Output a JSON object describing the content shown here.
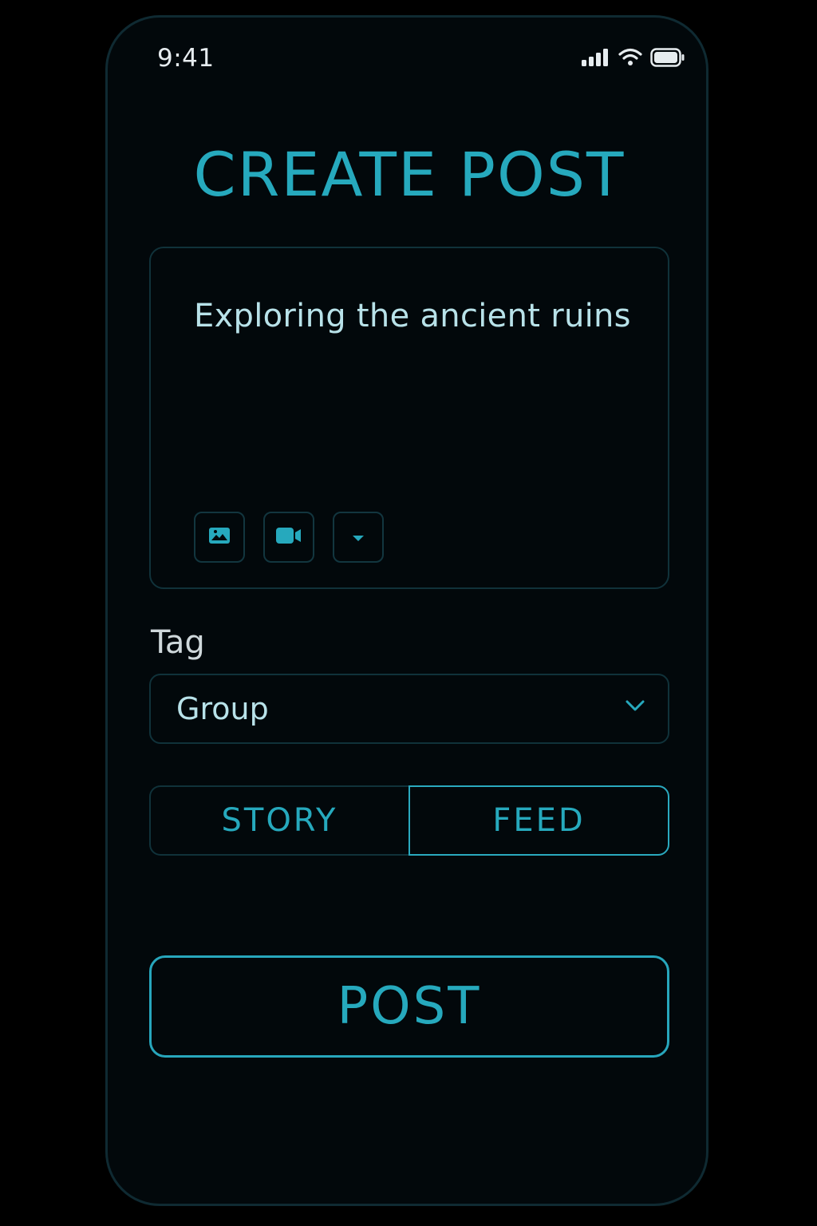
{
  "status_bar": {
    "time": "9:41",
    "icons": [
      "signal-icon",
      "wifi-icon",
      "battery-icon"
    ]
  },
  "header": {
    "title": "CREATE POST"
  },
  "composer": {
    "text": "Exploring the ancient ruins",
    "media_buttons": [
      "image-icon",
      "video-icon",
      "dropdown-icon"
    ]
  },
  "tag": {
    "label": "Tag",
    "selected": "Group"
  },
  "post_type": {
    "options": [
      {
        "label": "STORY",
        "selected": false
      },
      {
        "label": "FEED",
        "selected": true
      }
    ]
  },
  "actions": {
    "post_label": "POST"
  },
  "colors": {
    "accent": "#26a9bd",
    "background": "#02080b",
    "border": "#10323a",
    "text_light": "#b8e2e9"
  }
}
